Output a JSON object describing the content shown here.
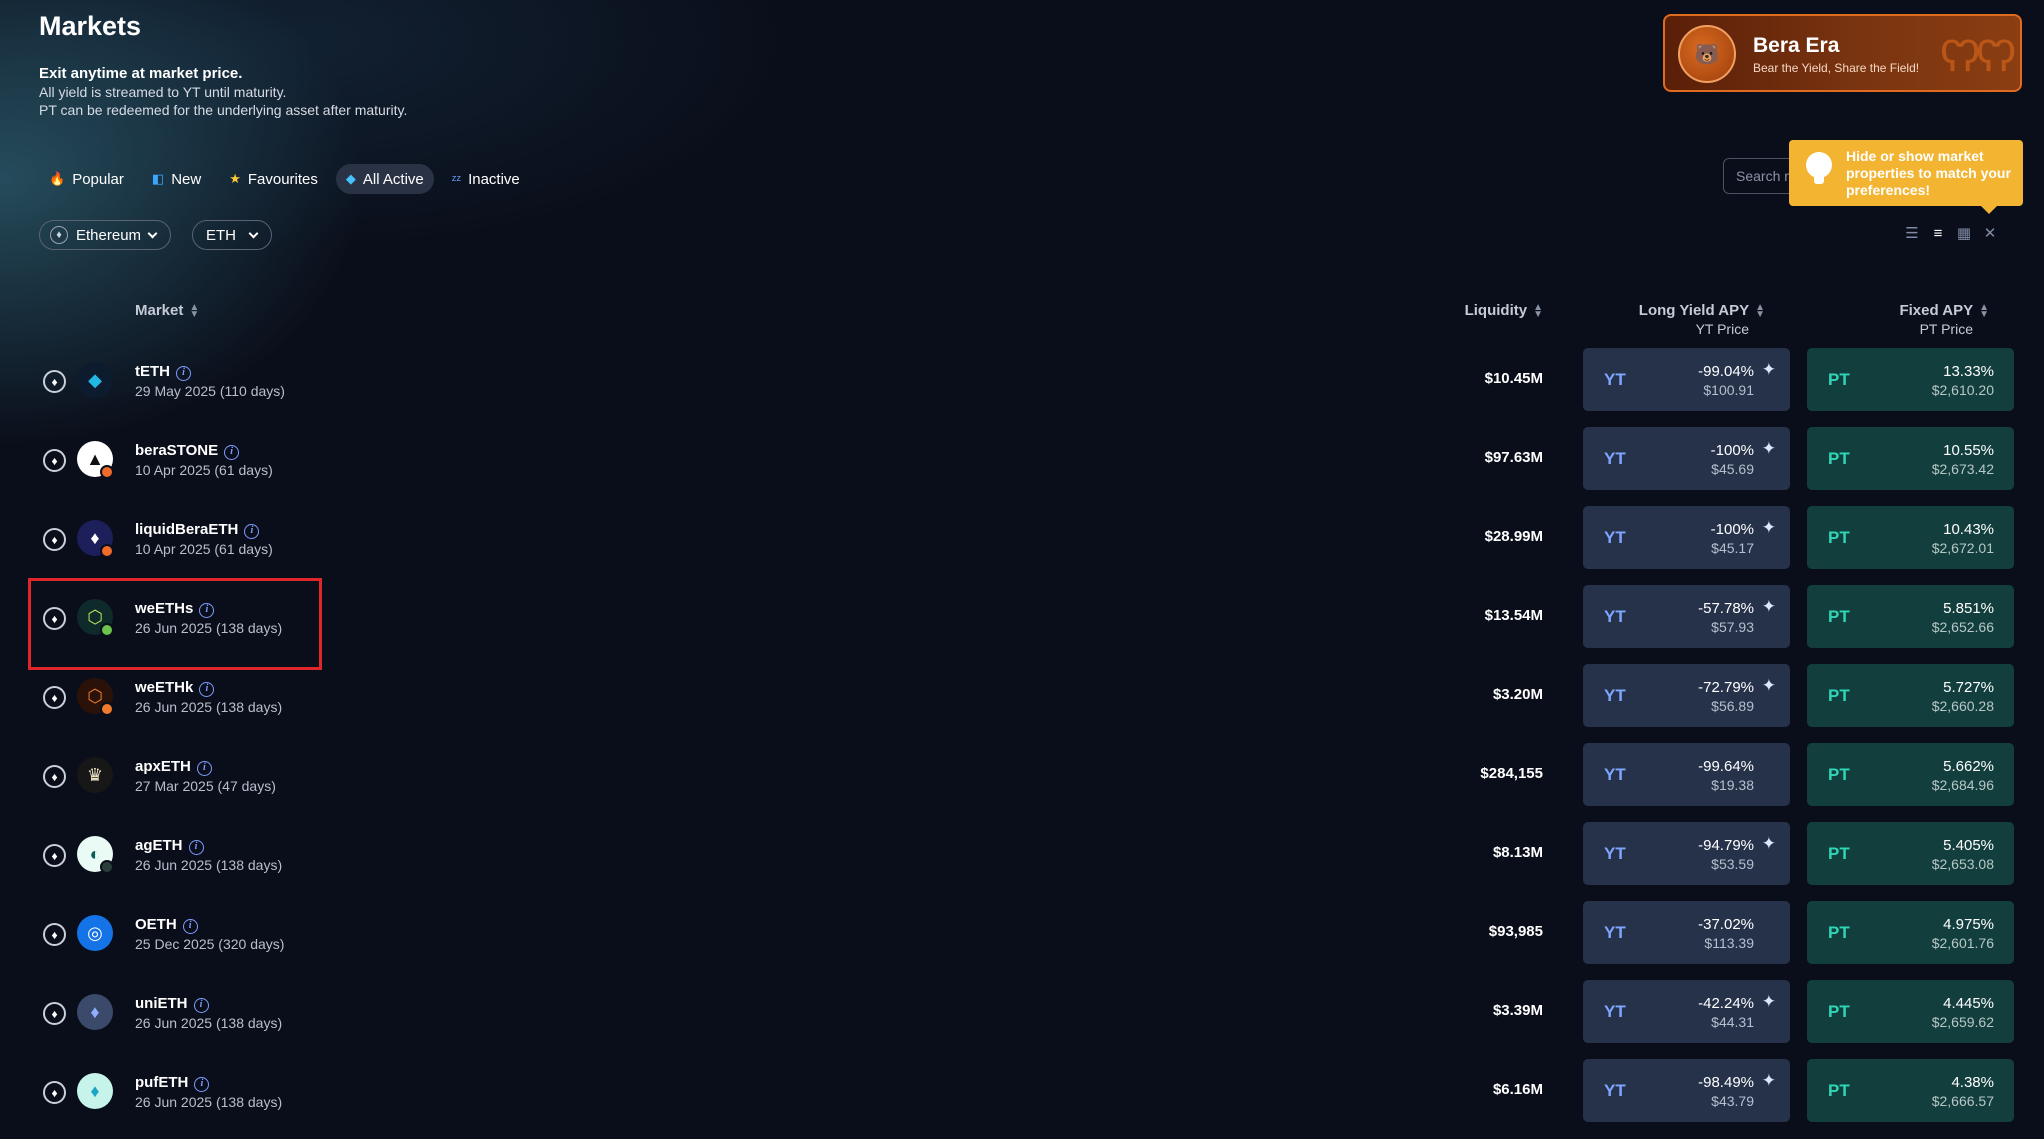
{
  "page": {
    "title": "Markets",
    "lead": "Exit anytime at market price.",
    "line2": "All yield is streamed to YT until maturity.",
    "line3": "PT can be redeemed for the underlying asset after maturity."
  },
  "banner": {
    "title": "Bera Era",
    "subtitle": "Bear the Yield, Share the Field!"
  },
  "tabs": [
    {
      "label": "Popular",
      "icon": "fire-icon"
    },
    {
      "label": "New",
      "icon": "new-icon"
    },
    {
      "label": "Favourites",
      "icon": "star-icon"
    },
    {
      "label": "All Active",
      "icon": "diamond-icon",
      "active": true
    },
    {
      "label": "Inactive",
      "icon": "zzz-icon"
    }
  ],
  "filters": {
    "chain": "Ethereum",
    "asset": "ETH"
  },
  "search": {
    "placeholder": "Search m"
  },
  "tooltip": {
    "text": "Hide or show market properties to match your preferences!"
  },
  "columns": {
    "market": "Market",
    "liquidity": "Liquidity",
    "long_yield": "Long Yield APY",
    "yt_price": "YT Price",
    "fixed_apy": "Fixed APY",
    "pt_price": "PT Price"
  },
  "labels": {
    "yt": "YT",
    "pt": "PT"
  },
  "rows": [
    {
      "name": "tETH",
      "date": "29 May 2025 (110 days)",
      "liquidity": "$10.45M",
      "yt_apy": "-99.04%",
      "yt_price": "$100.91",
      "yt_spark": true,
      "pt_apy": "13.33%",
      "pt_price": "$2,610.20"
    },
    {
      "name": "beraSTONE",
      "date": "10 Apr 2025 (61 days)",
      "liquidity": "$97.63M",
      "yt_apy": "-100%",
      "yt_price": "$45.69",
      "yt_spark": true,
      "pt_apy": "10.55%",
      "pt_price": "$2,673.42"
    },
    {
      "name": "liquidBeraETH",
      "date": "10 Apr 2025 (61 days)",
      "liquidity": "$28.99M",
      "yt_apy": "-100%",
      "yt_price": "$45.17",
      "yt_spark": true,
      "pt_apy": "10.43%",
      "pt_price": "$2,672.01"
    },
    {
      "name": "weETHs",
      "date": "26 Jun 2025 (138 days)",
      "liquidity": "$13.54M",
      "yt_apy": "-57.78%",
      "yt_price": "$57.93",
      "yt_spark": true,
      "pt_apy": "5.851%",
      "pt_price": "$2,652.66"
    },
    {
      "name": "weETHk",
      "date": "26 Jun 2025 (138 days)",
      "liquidity": "$3.20M",
      "yt_apy": "-72.79%",
      "yt_price": "$56.89",
      "yt_spark": true,
      "pt_apy": "5.727%",
      "pt_price": "$2,660.28"
    },
    {
      "name": "apxETH",
      "date": "27 Mar 2025 (47 days)",
      "liquidity": "$284,155",
      "yt_apy": "-99.64%",
      "yt_price": "$19.38",
      "yt_spark": false,
      "pt_apy": "5.662%",
      "pt_price": "$2,684.96"
    },
    {
      "name": "agETH",
      "date": "26 Jun 2025 (138 days)",
      "liquidity": "$8.13M",
      "yt_apy": "-94.79%",
      "yt_price": "$53.59",
      "yt_spark": true,
      "pt_apy": "5.405%",
      "pt_price": "$2,653.08"
    },
    {
      "name": "OETH",
      "date": "25 Dec 2025 (320 days)",
      "liquidity": "$93,985",
      "yt_apy": "-37.02%",
      "yt_price": "$113.39",
      "yt_spark": false,
      "pt_apy": "4.975%",
      "pt_price": "$2,601.76"
    },
    {
      "name": "uniETH",
      "date": "26 Jun 2025 (138 days)",
      "liquidity": "$3.39M",
      "yt_apy": "-42.24%",
      "yt_price": "$44.31",
      "yt_spark": true,
      "pt_apy": "4.445%",
      "pt_price": "$2,659.62"
    },
    {
      "name": "pufETH",
      "date": "26 Jun 2025 (138 days)",
      "liquidity": "$6.16M",
      "yt_apy": "-98.49%",
      "yt_price": "$43.79",
      "yt_spark": true,
      "pt_apy": "4.38%",
      "pt_price": "$2,666.57"
    }
  ],
  "colors": {
    "yt_accent": "#7fa6ff",
    "pt_accent": "#2fd7b6",
    "banner_orange": "#e06a1e",
    "tooltip_yellow": "#f2b431",
    "highlight_red": "#e0262b"
  }
}
